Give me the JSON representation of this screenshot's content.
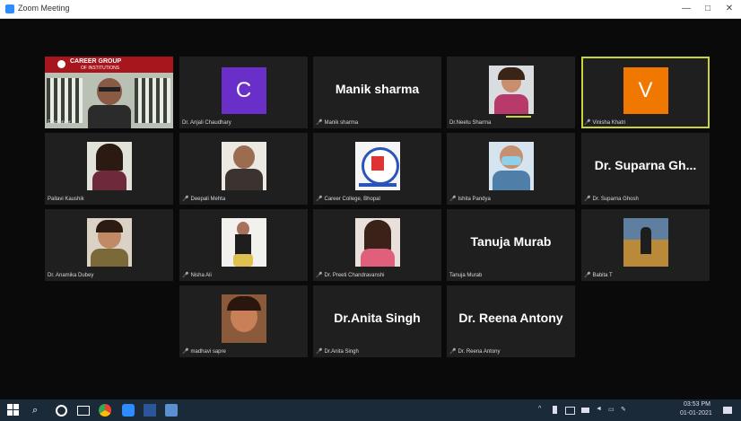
{
  "window": {
    "title": "Zoom Meeting",
    "minimize": "—",
    "maximize": "□",
    "close": "✕"
  },
  "colors": {
    "zoom_blue": "#2d8cff",
    "active_border": "#c8d43a",
    "mic_muted": "#e53935",
    "tile_bg": "#1f1f1f",
    "taskbar_bg": "#1b2a38"
  },
  "participants": [
    {
      "label": "Presenter",
      "type": "video",
      "muted": false
    },
    {
      "label": "Dr. Anjali Chaudhary",
      "type": "avatar",
      "initial": "C",
      "avatar_color": "#6a2fc9",
      "muted": false
    },
    {
      "label": "Manik sharma",
      "type": "name",
      "display_name": "Manik sharma",
      "muted": true
    },
    {
      "label": "Dr.Neetu Sharma",
      "type": "video",
      "muted": false
    },
    {
      "label": "Vinisha Khatri",
      "type": "avatar",
      "initial": "V",
      "avatar_color": "#f07800",
      "muted": true,
      "active_speaker": true
    },
    {
      "label": "Pallavi Kaushik",
      "type": "video",
      "muted": false
    },
    {
      "label": "Deepali Mehta",
      "type": "video",
      "muted": true
    },
    {
      "label": "Career College, Bhopal",
      "type": "video",
      "muted": true
    },
    {
      "label": "Ishita Pandya",
      "type": "video",
      "muted": true
    },
    {
      "label": "Dr. Suparna Ghosh",
      "type": "name",
      "display_name": "Dr. Suparna Gh...",
      "muted": true
    },
    {
      "label": "Dr. Anamika Dubey",
      "type": "video",
      "muted": false
    },
    {
      "label": "Nisha Ali",
      "type": "video",
      "muted": true
    },
    {
      "label": "Dr. Preeti Chandravanshi",
      "type": "video",
      "muted": true
    },
    {
      "label": "Tanuja Murab",
      "type": "name",
      "display_name": "Tanuja Murab",
      "muted": false
    },
    {
      "label": "Babita T",
      "type": "video",
      "muted": true
    },
    {
      "label": "madhavi sapre",
      "type": "video",
      "muted": true
    },
    {
      "label": "Dr.Anita Singh",
      "type": "name",
      "display_name": "Dr.Anita Singh",
      "muted": true
    },
    {
      "label": "Dr. Reena Antony",
      "type": "name",
      "display_name": "Dr. Reena Antony",
      "muted": true
    }
  ],
  "banner": {
    "line1": "CAREER GROUP",
    "line2": "OF INSTITUTIONS"
  },
  "taskbar": {
    "time": "03:53 PM",
    "date": "01-01-2021"
  }
}
